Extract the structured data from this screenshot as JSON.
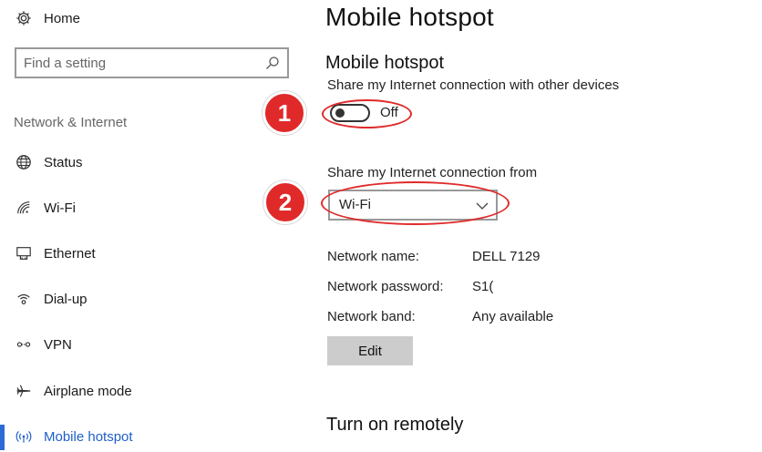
{
  "sidebar": {
    "home_label": "Home",
    "search_placeholder": "Find a setting",
    "section_label": "Network & Internet",
    "items": [
      {
        "label": "Status"
      },
      {
        "label": "Wi-Fi"
      },
      {
        "label": "Ethernet"
      },
      {
        "label": "Dial-up"
      },
      {
        "label": "VPN"
      },
      {
        "label": "Airplane mode"
      },
      {
        "label": "Mobile hotspot"
      }
    ],
    "active_item": "Mobile hotspot"
  },
  "main": {
    "page_title": "Mobile hotspot",
    "section_heading": "Mobile hotspot",
    "share_description": "Share my Internet connection with other devices",
    "toggle_state": "Off",
    "share_from_label": "Share my Internet connection from",
    "share_from_value": "Wi-Fi",
    "info": {
      "network_name_label": "Network name:",
      "network_name_value": "DELL 7129",
      "network_password_label": "Network password:",
      "network_password_value": "S1(",
      "network_band_label": "Network band:",
      "network_band_value": "Any available"
    },
    "edit_label": "Edit",
    "remote_heading": "Turn on remotely"
  },
  "annotations": {
    "badge_1": "1",
    "badge_2": "2",
    "color": "#e02a2a"
  },
  "colors": {
    "accent": "#1f5fc7",
    "button_bg": "#cccccc"
  }
}
